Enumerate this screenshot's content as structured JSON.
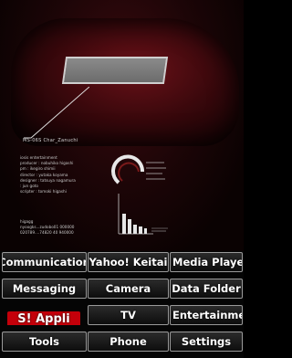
{
  "wallpaper": {
    "mech_name": "MS-06S Char_Zanuchi",
    "credits": [
      "iosis entertainment",
      "producer : nobuhiko higashi",
      "pm : ikegiro shimii",
      "director : yutaka koyama",
      "designer : tatsuya nagamura",
      "             : jun goto",
      "scripter : tomoki higashi"
    ],
    "contact": [
      "higagg",
      "nyoogks...zudobo01 000000",
      "020789....74820  40 940000"
    ],
    "accent_color": "#c4000a"
  },
  "menu": {
    "rows": [
      [
        "Communication",
        "Yahoo! Keitai",
        "Media Playe"
      ],
      [
        "Messaging",
        "Camera",
        "Data Folder"
      ],
      [
        "S! Appli",
        "TV",
        "Entertainmen"
      ],
      [
        "Tools",
        "Phone",
        "Settings"
      ]
    ],
    "selected": "S! Appli"
  }
}
